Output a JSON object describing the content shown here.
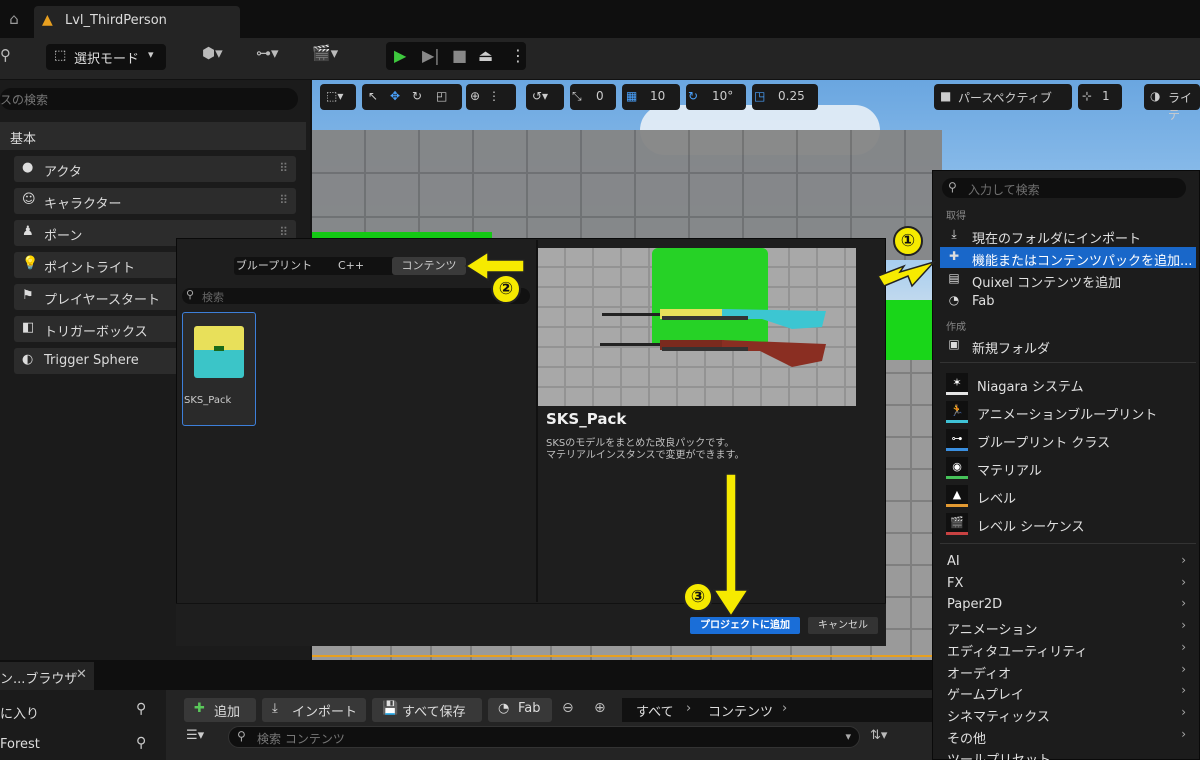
{
  "tabbar": {
    "level_tab": "Lvl_ThirdPerson"
  },
  "toolbar": {
    "mode_label": "選択モード"
  },
  "left_panel": {
    "search_placeholder": "スの検索",
    "category": "基本",
    "items": [
      {
        "label": "アクタ",
        "icon": "sphere-icon"
      },
      {
        "label": "キャラクター",
        "icon": "person-icon"
      },
      {
        "label": "ポーン",
        "icon": "pawn-icon"
      },
      {
        "label": "ポイントライト",
        "icon": "bulb-icon"
      },
      {
        "label": "プレイヤースタート",
        "icon": "flag-icon"
      },
      {
        "label": "トリガーボックス",
        "icon": "cube-icon"
      },
      {
        "label": "Trigger Sphere",
        "icon": "sphere-icon"
      }
    ]
  },
  "viewport_toolbar": {
    "snap_angle": "0",
    "grid_size": "10",
    "rotation_snap": "10°",
    "scale_snap": "0.25",
    "view_mode": "パースペクティブ",
    "camera_speed": "1",
    "lighting": "ライテ"
  },
  "dialog": {
    "tabs": [
      "ブループリント",
      "C++",
      "コンテンツ"
    ],
    "active_tab": "コンテンツ",
    "search_placeholder": "検索",
    "asset_name": "SKS_Pack",
    "preview_title": "SKS_Pack",
    "preview_desc_1": "SKSのモデルをまとめた改良パックです。",
    "preview_desc_2": "マテリアルインスタンスで変更ができます。",
    "add_button": "プロジェクトに追加",
    "cancel_button": "キャンセル"
  },
  "context_menu": {
    "search_placeholder": "入力して検索",
    "section_get": "取得",
    "get_items": [
      {
        "label": "現在のフォルダにインポート",
        "icon": "import-icon"
      },
      {
        "label": "機能またはコンテンツパックを追加...",
        "icon": "add-pack-icon",
        "highlighted": true
      },
      {
        "label": "Quixel コンテンツを追加",
        "icon": "quixel-icon"
      },
      {
        "label": "Fab",
        "icon": "fab-icon"
      }
    ],
    "section_create": "作成",
    "new_folder": "新規フォルダ",
    "create_items": [
      {
        "label": "Niagara システム",
        "icon": "niagara-icon",
        "color": "#e5e5e5"
      },
      {
        "label": "アニメーションブループリント",
        "icon": "anim-blueprint-icon",
        "color": "#3fc2d6"
      },
      {
        "label": "ブループリント クラス",
        "icon": "blueprint-class-icon",
        "color": "#3a8fe0"
      },
      {
        "label": "マテリアル",
        "icon": "material-icon",
        "color": "#46c35a"
      },
      {
        "label": "レベル",
        "icon": "level-icon",
        "color": "#e39a32"
      },
      {
        "label": "レベル シーケンス",
        "icon": "level-sequence-icon",
        "color": "#c84242"
      }
    ],
    "submenus": [
      "AI",
      "FX",
      "Paper2D",
      "アニメーション",
      "エディタユーティリティ",
      "オーディオ",
      "ゲームプレイ",
      "シネマティックス",
      "その他",
      "ツールプリセット"
    ]
  },
  "content_browser": {
    "tab_label": "ン...ブラウザ",
    "sidebar_favorites": "に入り",
    "sidebar_project": "Forest",
    "add_button": "追加",
    "import_button": "インポート",
    "save_all_button": "すべて保存",
    "fab_button": "Fab",
    "path_all": "すべて",
    "path_content": "コンテンツ",
    "search_placeholder": "検索 コンテンツ"
  },
  "annotations": {
    "step1": "①",
    "step2": "②",
    "step3": "③"
  },
  "colors": {
    "accent_blue": "#1967c9",
    "annotation_yellow": "#f6ea00",
    "play_green": "#3ec83e"
  }
}
